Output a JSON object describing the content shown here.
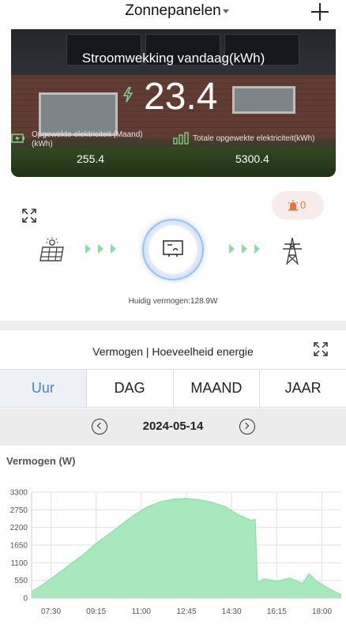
{
  "header": {
    "title": "Zonnepanelen"
  },
  "hero": {
    "title": "Stroomwekking vandaag(kWh)",
    "today_value": "23.4",
    "month_label_line1": "Opgewekte elektriciteit (Maand)",
    "month_label_line2": "(kWh)",
    "month_value": "255.4",
    "total_label": "Totale opgewekte elektriciteit(kWh)",
    "total_value": "5300.4"
  },
  "flow": {
    "alarm_count": "0",
    "current_power": "Huidig vermogen:128.9W"
  },
  "energy": {
    "section_title": "Vermogen | Hoeveelheid energie",
    "tabs": [
      "Uur",
      "DAG",
      "MAAND",
      "JAAR"
    ],
    "active_tab": 0,
    "date": "2024-05-14"
  },
  "chart_heading": "Vermogen (W)",
  "chart_data": {
    "type": "area",
    "title": "Vermogen (W)",
    "xlabel": "",
    "ylabel": "",
    "color": "#a8e8bd",
    "line_color": "#8fdca8",
    "grid": true,
    "ylim": [
      0,
      3300
    ],
    "yticks": [
      0,
      550,
      1100,
      1650,
      2200,
      2750,
      3300
    ],
    "xlim": [
      "06:45",
      "18:45"
    ],
    "xticks": [
      "07:30",
      "09:15",
      "11:00",
      "12:45",
      "14:30",
      "16:15",
      "18:00"
    ],
    "x": [
      "06:45",
      "07:15",
      "07:45",
      "08:15",
      "08:45",
      "09:15",
      "09:45",
      "10:15",
      "10:45",
      "11:15",
      "11:45",
      "12:15",
      "12:45",
      "13:15",
      "13:45",
      "14:15",
      "14:45",
      "15:15",
      "15:25",
      "15:30",
      "15:45",
      "16:15",
      "16:45",
      "17:15",
      "17:30",
      "17:45",
      "18:15",
      "18:45"
    ],
    "values": [
      200,
      450,
      750,
      1050,
      1350,
      1700,
      2000,
      2300,
      2600,
      2850,
      3000,
      3080,
      3100,
      3060,
      2980,
      2850,
      2600,
      2420,
      2450,
      480,
      600,
      520,
      620,
      450,
      760,
      550,
      300,
      100
    ]
  },
  "colors": {
    "accent": "#4a7fd6",
    "flow_arrow": "#8edba3",
    "alarm": "#e8743b"
  }
}
